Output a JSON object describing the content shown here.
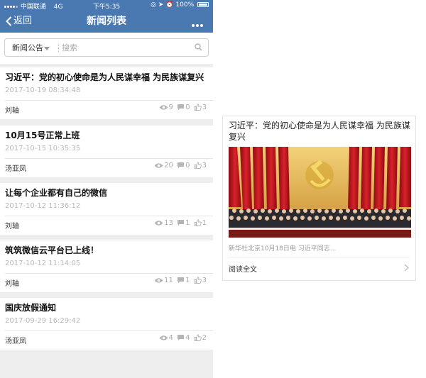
{
  "status_bar": {
    "carrier": "中国联通",
    "network": "4G",
    "time": "下午5:35",
    "battery": "100%"
  },
  "nav": {
    "back_label": "返回",
    "title": "新闻列表"
  },
  "search": {
    "category": "新闻公告",
    "placeholder": "搜索"
  },
  "news": [
    {
      "title": "习近平：党的初心使命是为人民谋幸福 为民族谋复兴",
      "date": "2017-10-19 08:34:48",
      "author": "刘轴",
      "views": "9",
      "comments": "0",
      "likes": "3"
    },
    {
      "title": "10月15号正常上班",
      "date": "2017-10-15 10:35:35",
      "author": "汤亚凤",
      "views": "20",
      "comments": "0",
      "likes": "3"
    },
    {
      "title": "让每个企业都有自己的微信",
      "date": "2017-10-12 11:36:12",
      "author": "刘轴",
      "views": "13",
      "comments": "1",
      "likes": "1"
    },
    {
      "title": "筑筑微信云平台已上线！",
      "date": "2017-10-12 11:14:05",
      "author": "刘轴",
      "views": "11",
      "comments": "1",
      "likes": "3"
    },
    {
      "title": "国庆放假通知",
      "date": "2017-09-29 16:29:42",
      "author": "汤亚凤",
      "views": "4",
      "comments": "4",
      "likes": "2"
    }
  ],
  "preview": {
    "title": "习近平：党的初心使命是为人民谋幸福 为民族谋复兴",
    "summary": "新华社北京10月18日电 习近平同志...",
    "read_full": "阅读全文"
  },
  "colors": {
    "accent": "#4a79b2",
    "page_bg": "#eeeeef",
    "curtain_red": "#c8131d",
    "emblem_gold": "#e8c04a"
  },
  "icons": [
    "back-chevron-icon",
    "more-dots-icon",
    "search-icon",
    "eye-icon",
    "comment-icon",
    "thumbs-up-icon",
    "chevron-right-icon"
  ]
}
